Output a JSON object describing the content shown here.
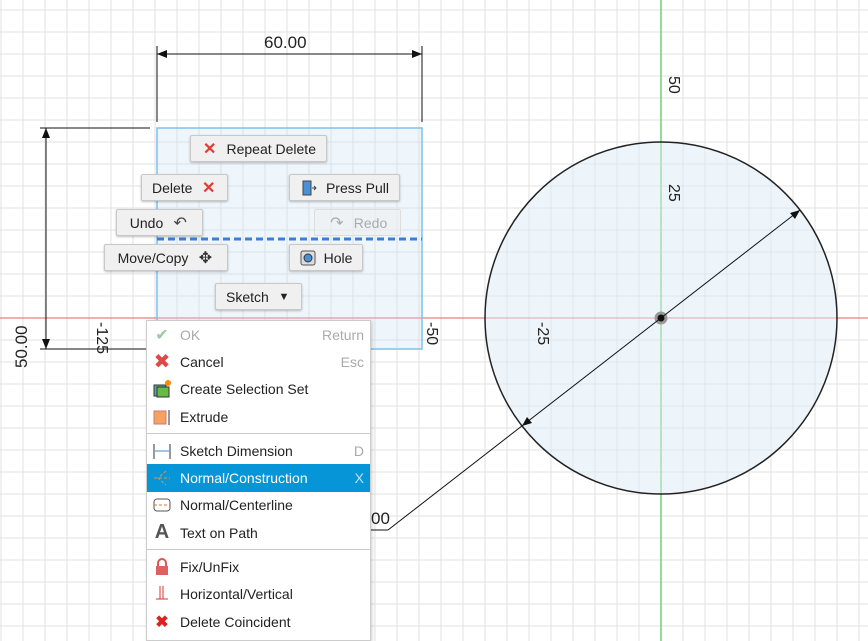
{
  "colors": {
    "x_axis": "#e88080",
    "y_axis": "#6fd36f",
    "selection": "#4a9bd6",
    "highlight": "#0696d7",
    "circle_fill": "#eaf4fb"
  },
  "dimensions": {
    "width": "60.00",
    "height": "50.00",
    "diameter_partial": "00"
  },
  "axis_labels": {
    "y50": "50",
    "y25": "25",
    "xm25": "-25",
    "xm50": "-50",
    "xm125": "-125"
  },
  "marking_menu": {
    "repeat_delete": "Repeat Delete",
    "delete": "Delete",
    "press_pull": "Press Pull",
    "undo": "Undo",
    "redo": "Redo",
    "move_copy": "Move/Copy",
    "hole": "Hole",
    "sketch": "Sketch"
  },
  "context_menu": {
    "items": [
      {
        "label": "OK",
        "shortcut": "Return",
        "icon": "check-icon",
        "disabled": true
      },
      {
        "label": "Cancel",
        "shortcut": "Esc",
        "icon": "cancel-icon"
      },
      {
        "label": "Create Selection Set",
        "shortcut": "",
        "icon": "selection-set-icon"
      },
      {
        "label": "Extrude",
        "shortcut": "",
        "icon": "extrude-icon"
      },
      {
        "label": "Sketch Dimension",
        "shortcut": "D",
        "icon": "dimension-icon"
      },
      {
        "label": "Normal/Construction",
        "shortcut": "X",
        "icon": "construction-icon",
        "highlighted": true
      },
      {
        "label": "Normal/Centerline",
        "shortcut": "",
        "icon": "centerline-icon"
      },
      {
        "label": "Text on Path",
        "shortcut": "",
        "icon": "text-icon"
      },
      {
        "label": "Fix/UnFix",
        "shortcut": "",
        "icon": "lock-icon"
      },
      {
        "label": "Horizontal/Vertical",
        "shortcut": "",
        "icon": "horizontal-vertical-icon"
      },
      {
        "label": "Delete Coincident",
        "shortcut": "",
        "icon": "delete-coincident-icon"
      }
    ]
  }
}
